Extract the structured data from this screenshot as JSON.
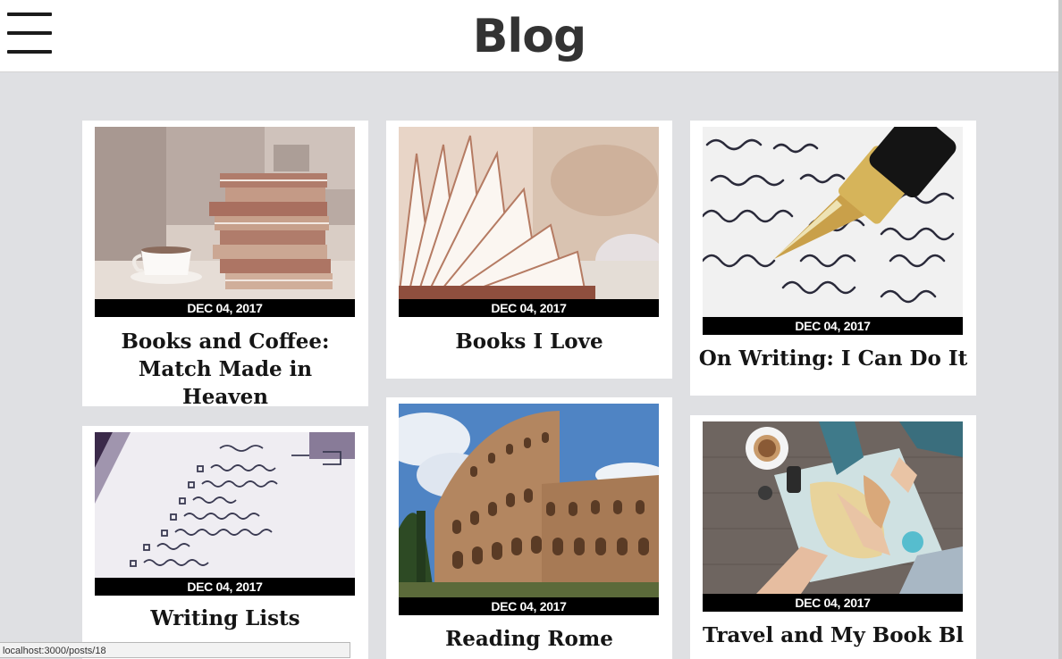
{
  "header": {
    "title": "Blog",
    "menu_icon": "hamburger-menu-icon"
  },
  "posts": [
    {
      "date": "DEC 04, 2017",
      "title": "Books and Coffee: Match Made in Heaven",
      "image": "books-and-coffee-photo"
    },
    {
      "date": "DEC 04, 2017",
      "title": "Books I Love",
      "image": "open-book-photo"
    },
    {
      "date": "DEC 04, 2017",
      "title": "On Writing: I Can Do It",
      "image": "fountain-pen-writing-photo"
    },
    {
      "date": "DEC 04, 2017",
      "title": "Writing Lists",
      "image": "handwritten-list-photo"
    },
    {
      "date": "DEC 04, 2017",
      "title": "Reading Rome",
      "image": "colosseum-photo"
    },
    {
      "date": "DEC 04, 2017",
      "title": "Travel and My Book Bl",
      "image": "map-planning-photo"
    }
  ],
  "status_bar": {
    "url": "localhost:3000/posts/18"
  },
  "colors": {
    "page_background": "#dfe0e3",
    "header_background": "#ffffff",
    "date_bar": "#000000"
  }
}
